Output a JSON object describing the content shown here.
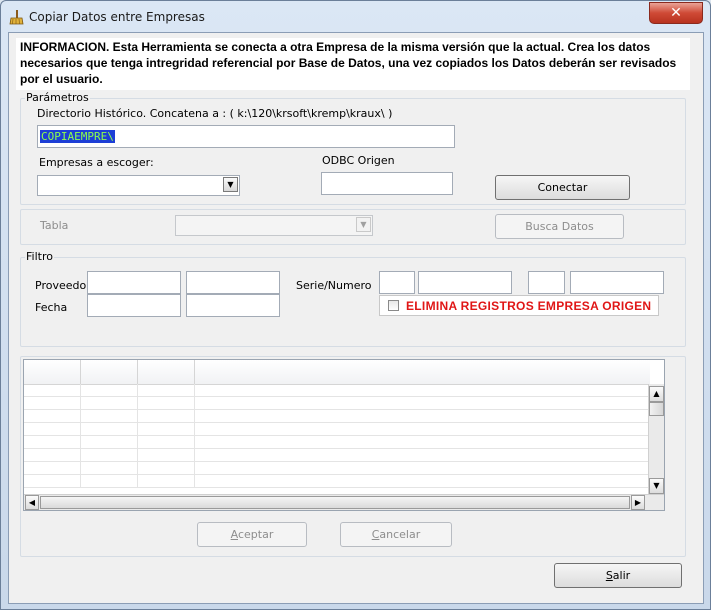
{
  "window": {
    "title": "Copiar Datos entre Empresas",
    "close_label": "✕"
  },
  "info": {
    "text": "INFORMACION. Esta Herramienta se conecta a otra Empresa de la misma versión que la actual. Crea los datos necesarios que tenga intregridad referencial por Base de Datos, una vez copiados los Datos deberán ser revisados por el usuario."
  },
  "parametros": {
    "legend": "Parámetros",
    "directorio_label": "Directorio Histórico. Concatena a :  ( k:\\120\\krsoft\\kremp\\kraux\\ )",
    "directorio_value": "COPIAEMPRE\\",
    "empresas_label": "Empresas a escoger:",
    "empresas_value": "",
    "odbc_label": "ODBC Origen",
    "odbc_value": "",
    "conectar_label": "Conectar"
  },
  "tabla": {
    "label": "Tabla",
    "value": "",
    "busca_label": "Busca Datos"
  },
  "filtro": {
    "legend": "Filtro",
    "proveedor_label": "Proveedor",
    "proveedor_from": "",
    "proveedor_to": "",
    "fecha_label": "Fecha",
    "fecha_from": "",
    "fecha_to": "",
    "serie_label": "Serie/Numero",
    "serie_from": "",
    "numero_from": "",
    "serie_to": "",
    "numero_to": "",
    "elimina_label": "ELIMINA REGISTROS EMPRESA ORIGEN"
  },
  "buttons": {
    "aceptar_ul": "A",
    "aceptar_rest": "ceptar",
    "cancelar_ul": "C",
    "cancelar_rest": "ancelar",
    "salir_ul": "S",
    "salir_rest": "alir"
  },
  "icons": {
    "app": "broom-icon",
    "scroll_up": "▲",
    "scroll_down": "▼",
    "scroll_left": "◀",
    "scroll_right": "▶",
    "dropdown": "▼"
  },
  "colors": {
    "selection_bg": "#1d3fd6",
    "selection_fg": "#8dff4a",
    "warning_red": "#e01616",
    "close_red": "#cf4a36"
  }
}
